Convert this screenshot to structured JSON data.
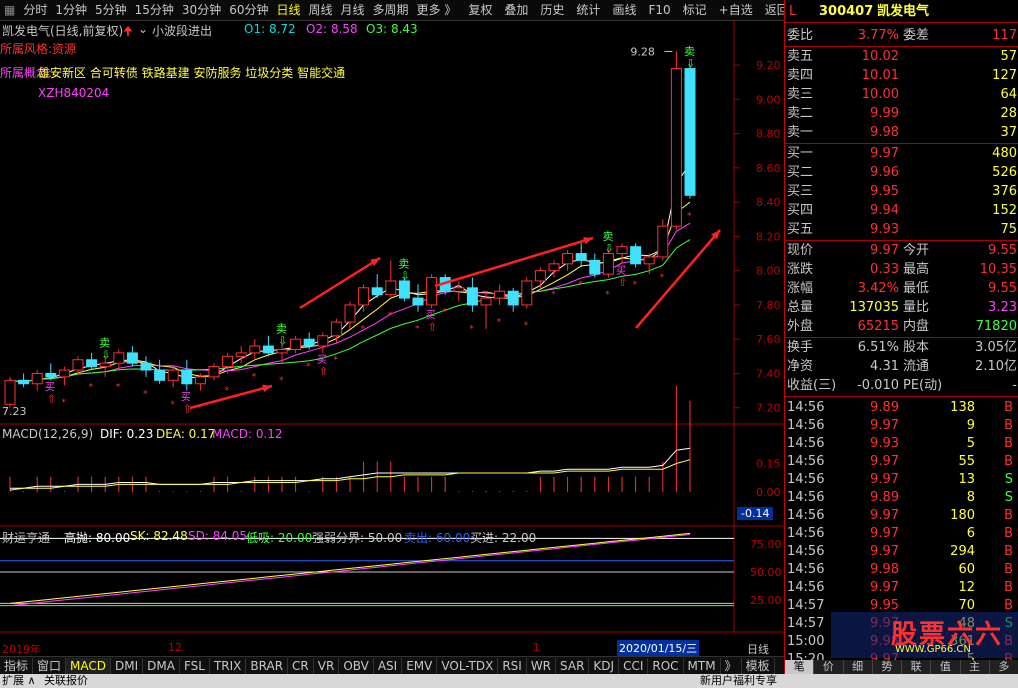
{
  "toolbar": {
    "left_items": [
      "分时",
      "1分钟",
      "5分钟",
      "15分钟",
      "30分钟",
      "60分钟",
      "日线",
      "周线",
      "月线",
      "多周期",
      "更多 》"
    ],
    "active": "日线",
    "right_items": [
      "复权",
      "叠加",
      "历史",
      "统计",
      "画线",
      "F10",
      "标记",
      "+自选",
      "返回"
    ]
  },
  "chart_header": {
    "name": "凯发电气(日线,前复权)",
    "indicator": "小波段进出",
    "o1": "O1: 8.72",
    "o2": "O2: 8.58",
    "o3": "O3: 8.43",
    "line1": "所属风格:资源",
    "line2_prefix": "所属概念:",
    "line2_concepts": "雄安新区 合可转债 铁路基建 安防服务 垃圾分类 智能交通",
    "line3": "XZH840204",
    "high_label": "9.28",
    "low_label": "7.23"
  },
  "signals": {
    "buy": "买",
    "sell": "卖"
  },
  "price_axis": [
    "9.20",
    "9.00",
    "8.80",
    "8.60",
    "8.40",
    "8.20",
    "8.00",
    "7.80",
    "7.60",
    "7.40",
    "7.20"
  ],
  "macd": {
    "title": "MACD(12,26,9)",
    "dif": "DIF: 0.23",
    "dea": "DEA: 0.17",
    "macd": "MACD: 0.12",
    "axis": [
      "0.15",
      "0.00"
    ],
    "current": "-0.14"
  },
  "cfx": {
    "title": "财运亨通",
    "high": "高抛: 80.00",
    "sk": "SK: 82.48",
    "sd": "SD: 84.05",
    "low": "低吸: 20.00",
    "qr": "强弱分界: 50.00",
    "sell": "卖出: 60.00",
    "buy": "买进: 22.00",
    "axis": [
      "75.00",
      "50.00",
      "25.00"
    ]
  },
  "date_axis": {
    "d1": "2019年",
    "d2": "12",
    "d3": "1",
    "d4": "2020/01/15/三",
    "period": "日线"
  },
  "tabs": [
    "指标",
    "窗口",
    "MACD",
    "DMI",
    "DMA",
    "FSL",
    "TRIX",
    "BRAR",
    "CR",
    "VR",
    "OBV",
    "ASI",
    "EMV",
    "VOL-TDX",
    "RSI",
    "WR",
    "SAR",
    "KDJ",
    "CCI",
    "ROC",
    "MTM",
    "》",
    "模板"
  ],
  "tabs_active": "MACD",
  "status": {
    "left1": "扩展 ∧",
    "left2": "关联报价",
    "right": "新用户福利专享"
  },
  "quote": {
    "marker": "L",
    "code": "300407",
    "name": "凯发电气",
    "wb_label": "委比",
    "wb": "3.77%",
    "wc_label": "委差",
    "wc": "117",
    "asks": [
      [
        "卖五",
        "10.02",
        "57"
      ],
      [
        "卖四",
        "10.01",
        "127"
      ],
      [
        "卖三",
        "10.00",
        "64"
      ],
      [
        "卖二",
        "9.99",
        "28"
      ],
      [
        "卖一",
        "9.98",
        "37"
      ]
    ],
    "bids": [
      [
        "买一",
        "9.97",
        "480"
      ],
      [
        "买二",
        "9.96",
        "526"
      ],
      [
        "买三",
        "9.95",
        "376"
      ],
      [
        "买四",
        "9.94",
        "152"
      ],
      [
        "买五",
        "9.93",
        "75"
      ]
    ],
    "stats": [
      [
        "现价",
        "9.97",
        "今开",
        "9.55"
      ],
      [
        "涨跌",
        "0.33",
        "最高",
        "10.35"
      ],
      [
        "涨幅",
        "3.42%",
        "最低",
        "9.55"
      ],
      [
        "总量",
        "137035",
        "量比",
        "3.23"
      ],
      [
        "外盘",
        "65215",
        "内盘",
        "71820"
      ]
    ],
    "fund": [
      [
        "换手",
        "6.51%",
        "股本",
        "3.05亿"
      ],
      [
        "净资",
        "4.31",
        "流通",
        "2.10亿"
      ],
      [
        "收益(三)",
        "-0.010",
        "PE(动)",
        "-"
      ]
    ],
    "ticks": [
      [
        "14:56",
        "9.89",
        "138",
        "B"
      ],
      [
        "14:56",
        "9.97",
        "9",
        "B"
      ],
      [
        "14:56",
        "9.93",
        "5",
        "B"
      ],
      [
        "14:56",
        "9.97",
        "55",
        "B"
      ],
      [
        "14:56",
        "9.97",
        "13",
        "S"
      ],
      [
        "14:56",
        "9.89",
        "8",
        "S"
      ],
      [
        "14:56",
        "9.97",
        "180",
        "B"
      ],
      [
        "14:56",
        "9.97",
        "6",
        "B"
      ],
      [
        "14:56",
        "9.97",
        "294",
        "B"
      ],
      [
        "14:56",
        "9.98",
        "60",
        "B"
      ],
      [
        "14:56",
        "9.97",
        "12",
        "B"
      ],
      [
        "14:57",
        "9.95",
        "70",
        "B"
      ],
      [
        "14:57",
        "9.97",
        "48",
        "S"
      ],
      [
        "15:00",
        "9.98",
        "361",
        "B"
      ],
      [
        "15:20",
        "9.97",
        "5",
        "B"
      ]
    ],
    "bottom_tabs": [
      "笔",
      "价",
      "细",
      "势",
      "联",
      "值",
      "主",
      "多"
    ],
    "watermark": "股票六六",
    "watermark_url": "WWW.GP66.CN"
  },
  "chart_data": {
    "type": "candlestick",
    "candles": [
      [
        7.22,
        7.38,
        7.2,
        7.36
      ],
      [
        7.36,
        7.4,
        7.32,
        7.34
      ],
      [
        7.34,
        7.42,
        7.3,
        7.4
      ],
      [
        7.4,
        7.46,
        7.36,
        7.38
      ],
      [
        7.38,
        7.44,
        7.33,
        7.42
      ],
      [
        7.42,
        7.5,
        7.39,
        7.48
      ],
      [
        7.48,
        7.52,
        7.42,
        7.44
      ],
      [
        7.44,
        7.5,
        7.38,
        7.46
      ],
      [
        7.46,
        7.54,
        7.42,
        7.52
      ],
      [
        7.52,
        7.56,
        7.44,
        7.46
      ],
      [
        7.46,
        7.5,
        7.38,
        7.42
      ],
      [
        7.42,
        7.48,
        7.34,
        7.36
      ],
      [
        7.36,
        7.44,
        7.32,
        7.42
      ],
      [
        7.42,
        7.48,
        7.3,
        7.34
      ],
      [
        7.34,
        7.4,
        7.3,
        7.38
      ],
      [
        7.38,
        7.46,
        7.36,
        7.44
      ],
      [
        7.44,
        7.52,
        7.4,
        7.5
      ],
      [
        7.5,
        7.56,
        7.46,
        7.52
      ],
      [
        7.52,
        7.6,
        7.48,
        7.56
      ],
      [
        7.56,
        7.62,
        7.5,
        7.52
      ],
      [
        7.52,
        7.58,
        7.46,
        7.54
      ],
      [
        7.54,
        7.62,
        7.52,
        7.6
      ],
      [
        7.6,
        7.64,
        7.54,
        7.56
      ],
      [
        7.56,
        7.64,
        7.52,
        7.62
      ],
      [
        7.62,
        7.72,
        7.58,
        7.7
      ],
      [
        7.7,
        7.82,
        7.66,
        7.8
      ],
      [
        7.8,
        7.92,
        7.76,
        7.9
      ],
      [
        7.9,
        7.98,
        7.84,
        7.86
      ],
      [
        7.86,
        8.06,
        7.84,
        7.94
      ],
      [
        7.94,
        7.96,
        7.82,
        7.84
      ],
      [
        7.84,
        7.92,
        7.76,
        7.8
      ],
      [
        7.8,
        7.98,
        7.78,
        7.96
      ],
      [
        7.96,
        7.98,
        7.86,
        7.88
      ],
      [
        7.88,
        7.94,
        7.82,
        7.9
      ],
      [
        7.9,
        7.96,
        7.76,
        7.8
      ],
      [
        7.8,
        7.88,
        7.66,
        7.84
      ],
      [
        7.84,
        7.92,
        7.8,
        7.88
      ],
      [
        7.88,
        7.9,
        7.76,
        7.8
      ],
      [
        7.8,
        7.96,
        7.78,
        7.94
      ],
      [
        7.94,
        8.02,
        7.9,
        8.0
      ],
      [
        8.0,
        8.06,
        7.96,
        8.04
      ],
      [
        8.04,
        8.12,
        8.0,
        8.1
      ],
      [
        8.1,
        8.16,
        8.02,
        8.06
      ],
      [
        8.06,
        8.1,
        7.96,
        7.98
      ],
      [
        7.98,
        8.12,
        7.96,
        8.1
      ],
      [
        8.1,
        8.16,
        8.04,
        8.14
      ],
      [
        8.14,
        8.16,
        8.02,
        8.04
      ],
      [
        8.04,
        8.1,
        7.98,
        8.08
      ],
      [
        8.08,
        8.3,
        8.06,
        8.26
      ],
      [
        8.26,
        9.28,
        8.24,
        9.18
      ],
      [
        9.18,
        9.2,
        8.42,
        8.44
      ]
    ],
    "ylim": [
      7.14,
      9.3
    ],
    "macd_dif": [
      0.02,
      0.02,
      0.03,
      0.03,
      0.03,
      0.04,
      0.04,
      0.04,
      0.05,
      0.05,
      0.05,
      0.04,
      0.04,
      0.04,
      0.04,
      0.05,
      0.05,
      0.05,
      0.06,
      0.06,
      0.06,
      0.06,
      0.06,
      0.07,
      0.07,
      0.08,
      0.09,
      0.1,
      0.1,
      0.1,
      0.1,
      0.1,
      0.1,
      0.1,
      0.1,
      0.1,
      0.1,
      0.1,
      0.1,
      0.11,
      0.11,
      0.12,
      0.12,
      0.12,
      0.12,
      0.13,
      0.13,
      0.13,
      0.14,
      0.22,
      0.23
    ],
    "macd_dea": [
      0.01,
      0.02,
      0.02,
      0.02,
      0.03,
      0.03,
      0.03,
      0.03,
      0.04,
      0.04,
      0.04,
      0.04,
      0.04,
      0.04,
      0.04,
      0.04,
      0.04,
      0.05,
      0.05,
      0.05,
      0.05,
      0.05,
      0.06,
      0.06,
      0.06,
      0.07,
      0.07,
      0.08,
      0.08,
      0.09,
      0.09,
      0.09,
      0.09,
      0.1,
      0.1,
      0.1,
      0.1,
      0.1,
      0.1,
      0.1,
      0.1,
      0.11,
      0.11,
      0.11,
      0.11,
      0.12,
      0.12,
      0.12,
      0.12,
      0.15,
      0.17
    ]
  }
}
